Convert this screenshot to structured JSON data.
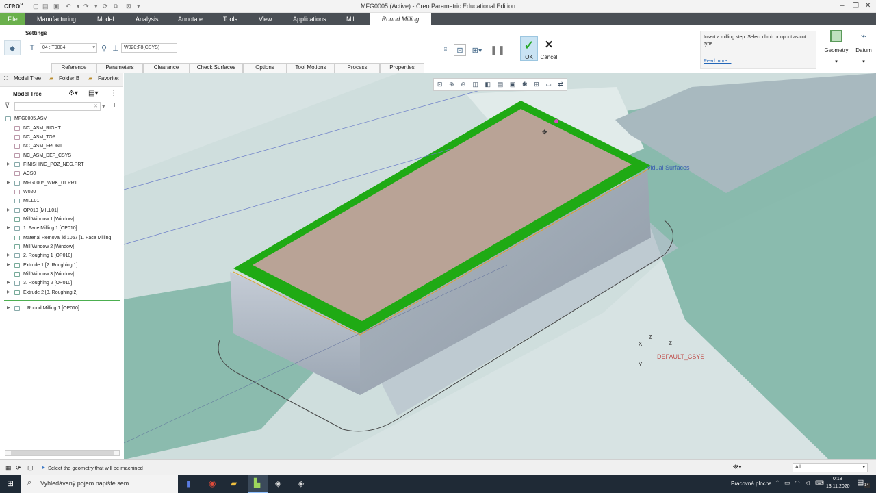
{
  "titlebar": {
    "logo": "creo°",
    "title": "MFG0005 (Active) - Creo Parametric Educational Edition",
    "win_min": "–",
    "win_restore": "❐",
    "win_close": "✕"
  },
  "menu": {
    "file": "File",
    "items": [
      "Manufacturing",
      "Model",
      "Analysis",
      "Annotate",
      "Tools",
      "View",
      "Applications",
      "Mill"
    ],
    "active_tab": "Round Milling"
  },
  "ribbon": {
    "settings_label": "Settings",
    "tool_value": "04 : T0004",
    "csys_value": "W020:F8(CSYS)",
    "tabs": [
      "Reference",
      "Parameters",
      "Clearance",
      "Check Surfaces",
      "Options",
      "Tool Motions",
      "Process",
      "Properties"
    ],
    "ok_label": "OK",
    "cancel_label": "Cancel",
    "hint_text": "Insert a milling step. Select climb or upcut as cut type.",
    "read_more": "Read more...",
    "geometry_label": "Geometry",
    "datum_label": "Datum"
  },
  "panel": {
    "tabs": [
      "Model Tree",
      "Folder B",
      "Favorite:"
    ],
    "tree_title": "Model Tree",
    "filter_placeholder": "",
    "items": [
      "MFG0005.ASM",
      "NC_ASM_RIGHT",
      "NC_ASM_TOP",
      "NC_ASM_FRONT",
      "NC_ASM_DEF_CSYS",
      "FINISHING_POZ_NEG.PRT",
      "ACS0",
      "MFG0005_WRK_01.PRT",
      "W020",
      "MILL01",
      "OP010 [MILL01]",
      "Mill Window 1 [Window]",
      "1. Face Milling 1 [OP010]",
      "Material Removal id 1057 [1. Face Milling",
      "Mill Window 2 [Window]",
      "2. Roughing 1 [OP010]",
      "Extrude 1 [2. Roughing 1]",
      "Mill Window 3 [Window]",
      "3. Roughing 2 [OP010]",
      "Extrude 2 [3. Roughing 2]",
      "Round Milling 1 [OP010]"
    ]
  },
  "viewport": {
    "surface_label": "vidual Surfaces",
    "csys_label": "DEFAULT_CSYS",
    "axis_x": "X",
    "axis_y": "Y",
    "axis_z": "Z"
  },
  "status": {
    "message": "Select the geometry that will be machined",
    "filter_value": "All"
  },
  "taskbar": {
    "search_placeholder": "Vyhledávaný pojem napište sem",
    "desktop_label": "Pracovná plocha",
    "time": "0:18",
    "date": "13.11.2020",
    "notification_count": "14"
  },
  "colors": {
    "menu_bg": "#4a4f55",
    "file_tab": "#6ab04c",
    "viewport_bg": "#d7e3e3",
    "highlight_green": "#22b514"
  }
}
